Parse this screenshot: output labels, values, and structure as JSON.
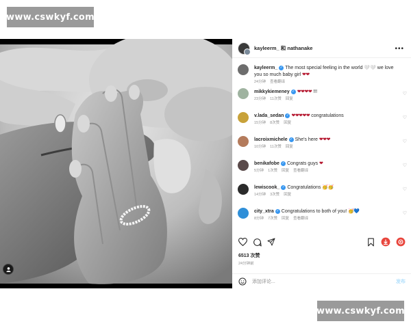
{
  "watermark": {
    "text": "www.cswkyf.com"
  },
  "header": {
    "names": "kayleerm_ 和 nathanake",
    "more": "•••"
  },
  "comments": [
    {
      "user": "kayleerm_",
      "verified": true,
      "text": "The most special feeling in the world 🤍🤍 we love you so much baby girl",
      "hearts": "❤❤",
      "meta": [
        "24分钟",
        "查看翻译"
      ],
      "avatar_color": "#6d6d6d",
      "has_like": false
    },
    {
      "user": "mikkykiemeney",
      "verified": true,
      "text": "!!!",
      "hearts": "❤❤❤❤",
      "meta": [
        "23分钟",
        "11次赞",
        "回复"
      ],
      "avatar_color": "#9fb3a0",
      "has_like": true
    },
    {
      "user": "v.lada_sedan",
      "verified": true,
      "text": "congratulations",
      "hearts": "❤❤❤❤❤",
      "meta": [
        "15分钟",
        "8次赞",
        "回复"
      ],
      "avatar_color": "#c8a23a",
      "has_like": true
    },
    {
      "user": "lacroixmichele",
      "verified": true,
      "text": "She's here",
      "hearts": "❤❤❤",
      "meta": [
        "10分钟",
        "11次赞",
        "回复"
      ],
      "avatar_color": "#b47b5c",
      "has_like": true
    },
    {
      "user": "benikafobe",
      "verified": true,
      "text": "Congrats guys",
      "hearts": "❤",
      "meta": [
        "5分钟",
        "1次赞",
        "回复",
        "查看翻译"
      ],
      "avatar_color": "#5a4a4a",
      "has_like": true
    },
    {
      "user": "lewiscook_",
      "verified": true,
      "text": "Congratulations",
      "hearts": "🥳🥳",
      "meta": [
        "14分钟",
        "3次赞",
        "回复"
      ],
      "avatar_color": "#2b2b2b",
      "has_like": true
    },
    {
      "user": "city_xtra",
      "verified": true,
      "text": "Congratulations to both of you!",
      "hearts": "🥳💙",
      "meta": [
        "8分钟",
        "7次赞",
        "回复",
        "查看翻译"
      ],
      "avatar_color": "#2f8fd8",
      "has_like": true
    }
  ],
  "likes": "6513 次赞",
  "time": "24分钟前",
  "add_comment": {
    "placeholder": "添加评论...",
    "post_label": "发布"
  },
  "icons": [
    "heart-icon",
    "comment-icon",
    "share-icon",
    "save-icon",
    "download-icon",
    "record-icon",
    "emoji-icon",
    "user-tag-icon",
    "more-icon"
  ],
  "colors": {
    "verified": "#3897f0",
    "heart": "#b3122a",
    "download_badge": "#e8453c",
    "record_badge": "#e8453c",
    "post_disabled": "#b2dffc"
  }
}
